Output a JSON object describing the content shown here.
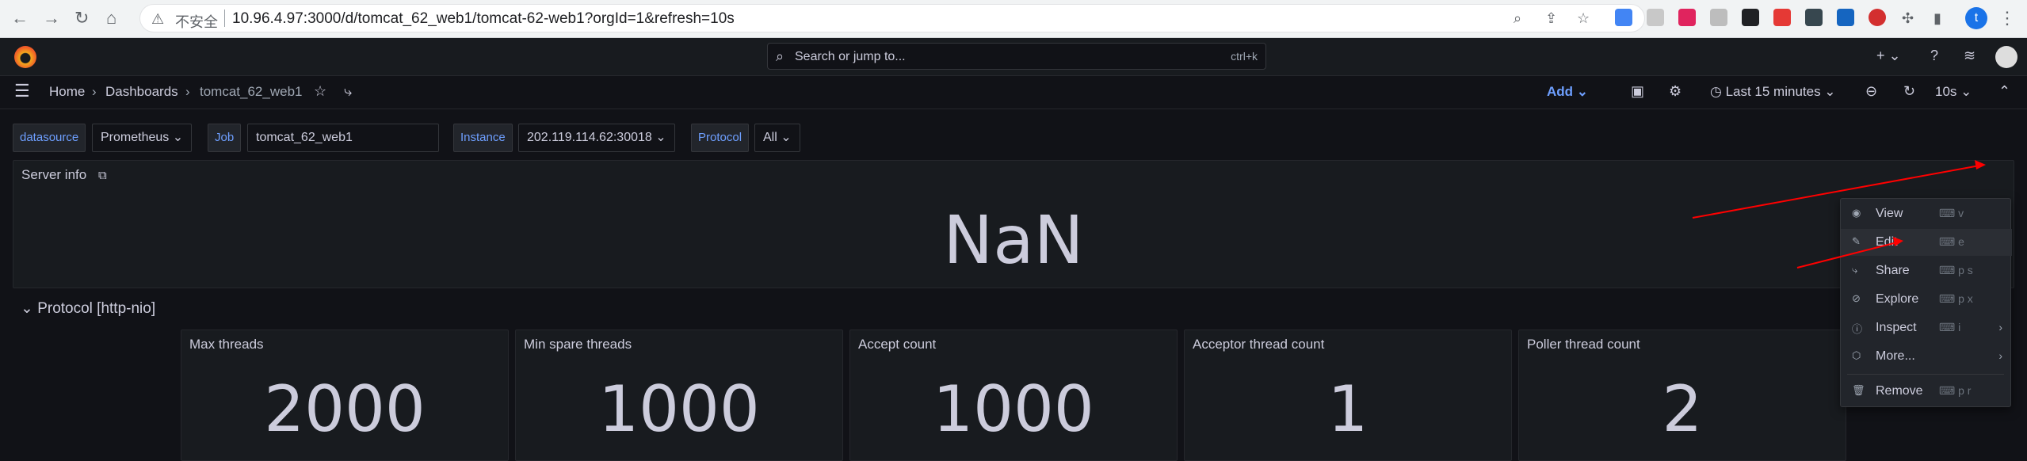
{
  "browser": {
    "insecure_label": "不安全",
    "url": "10.96.4.97:3000/d/tomcat_62_web1/tomcat-62-web1?orgId=1&refresh=10s",
    "profile_initial": "t"
  },
  "topbar": {
    "search_placeholder": "Search or jump to...",
    "search_shortcut": "ctrl+k"
  },
  "breadcrumb": {
    "home": "Home",
    "dashboards": "Dashboards",
    "current": "tomcat_62_web1"
  },
  "toolbar": {
    "add_label": "Add",
    "time_range": "Last 15 minutes",
    "refresh_interval": "10s"
  },
  "variables": {
    "datasource_label": "datasource",
    "datasource_value": "Prometheus",
    "job_label": "Job",
    "job_value": "tomcat_62_web1",
    "instance_label": "Instance",
    "instance_value": "202.119.114.62:30018",
    "protocol_label": "Protocol",
    "protocol_value": "All"
  },
  "server_info": {
    "title": "Server info",
    "value": "NaN"
  },
  "row": {
    "title": "Protocol [http-nio]"
  },
  "stats": [
    {
      "title": "Max threads",
      "value": "2000"
    },
    {
      "title": "Min spare threads",
      "value": "1000"
    },
    {
      "title": "Accept count",
      "value": "1000"
    },
    {
      "title": "Acceptor thread count",
      "value": "1"
    },
    {
      "title": "Poller thread count",
      "value": "2"
    }
  ],
  "panel_menu": {
    "items": [
      {
        "label": "View",
        "shortcut": "v"
      },
      {
        "label": "Edit",
        "shortcut": "e"
      },
      {
        "label": "Share",
        "shortcut": "p s"
      },
      {
        "label": "Explore",
        "shortcut": "p x"
      },
      {
        "label": "Inspect",
        "shortcut": "i"
      },
      {
        "label": "More...",
        "shortcut": ""
      },
      {
        "label": "Remove",
        "shortcut": "p r"
      }
    ]
  },
  "colors": {
    "background": "#111217",
    "panel": "#181b1f",
    "accent": "#6e9fff",
    "annotation_arrow": "#ff0000"
  }
}
